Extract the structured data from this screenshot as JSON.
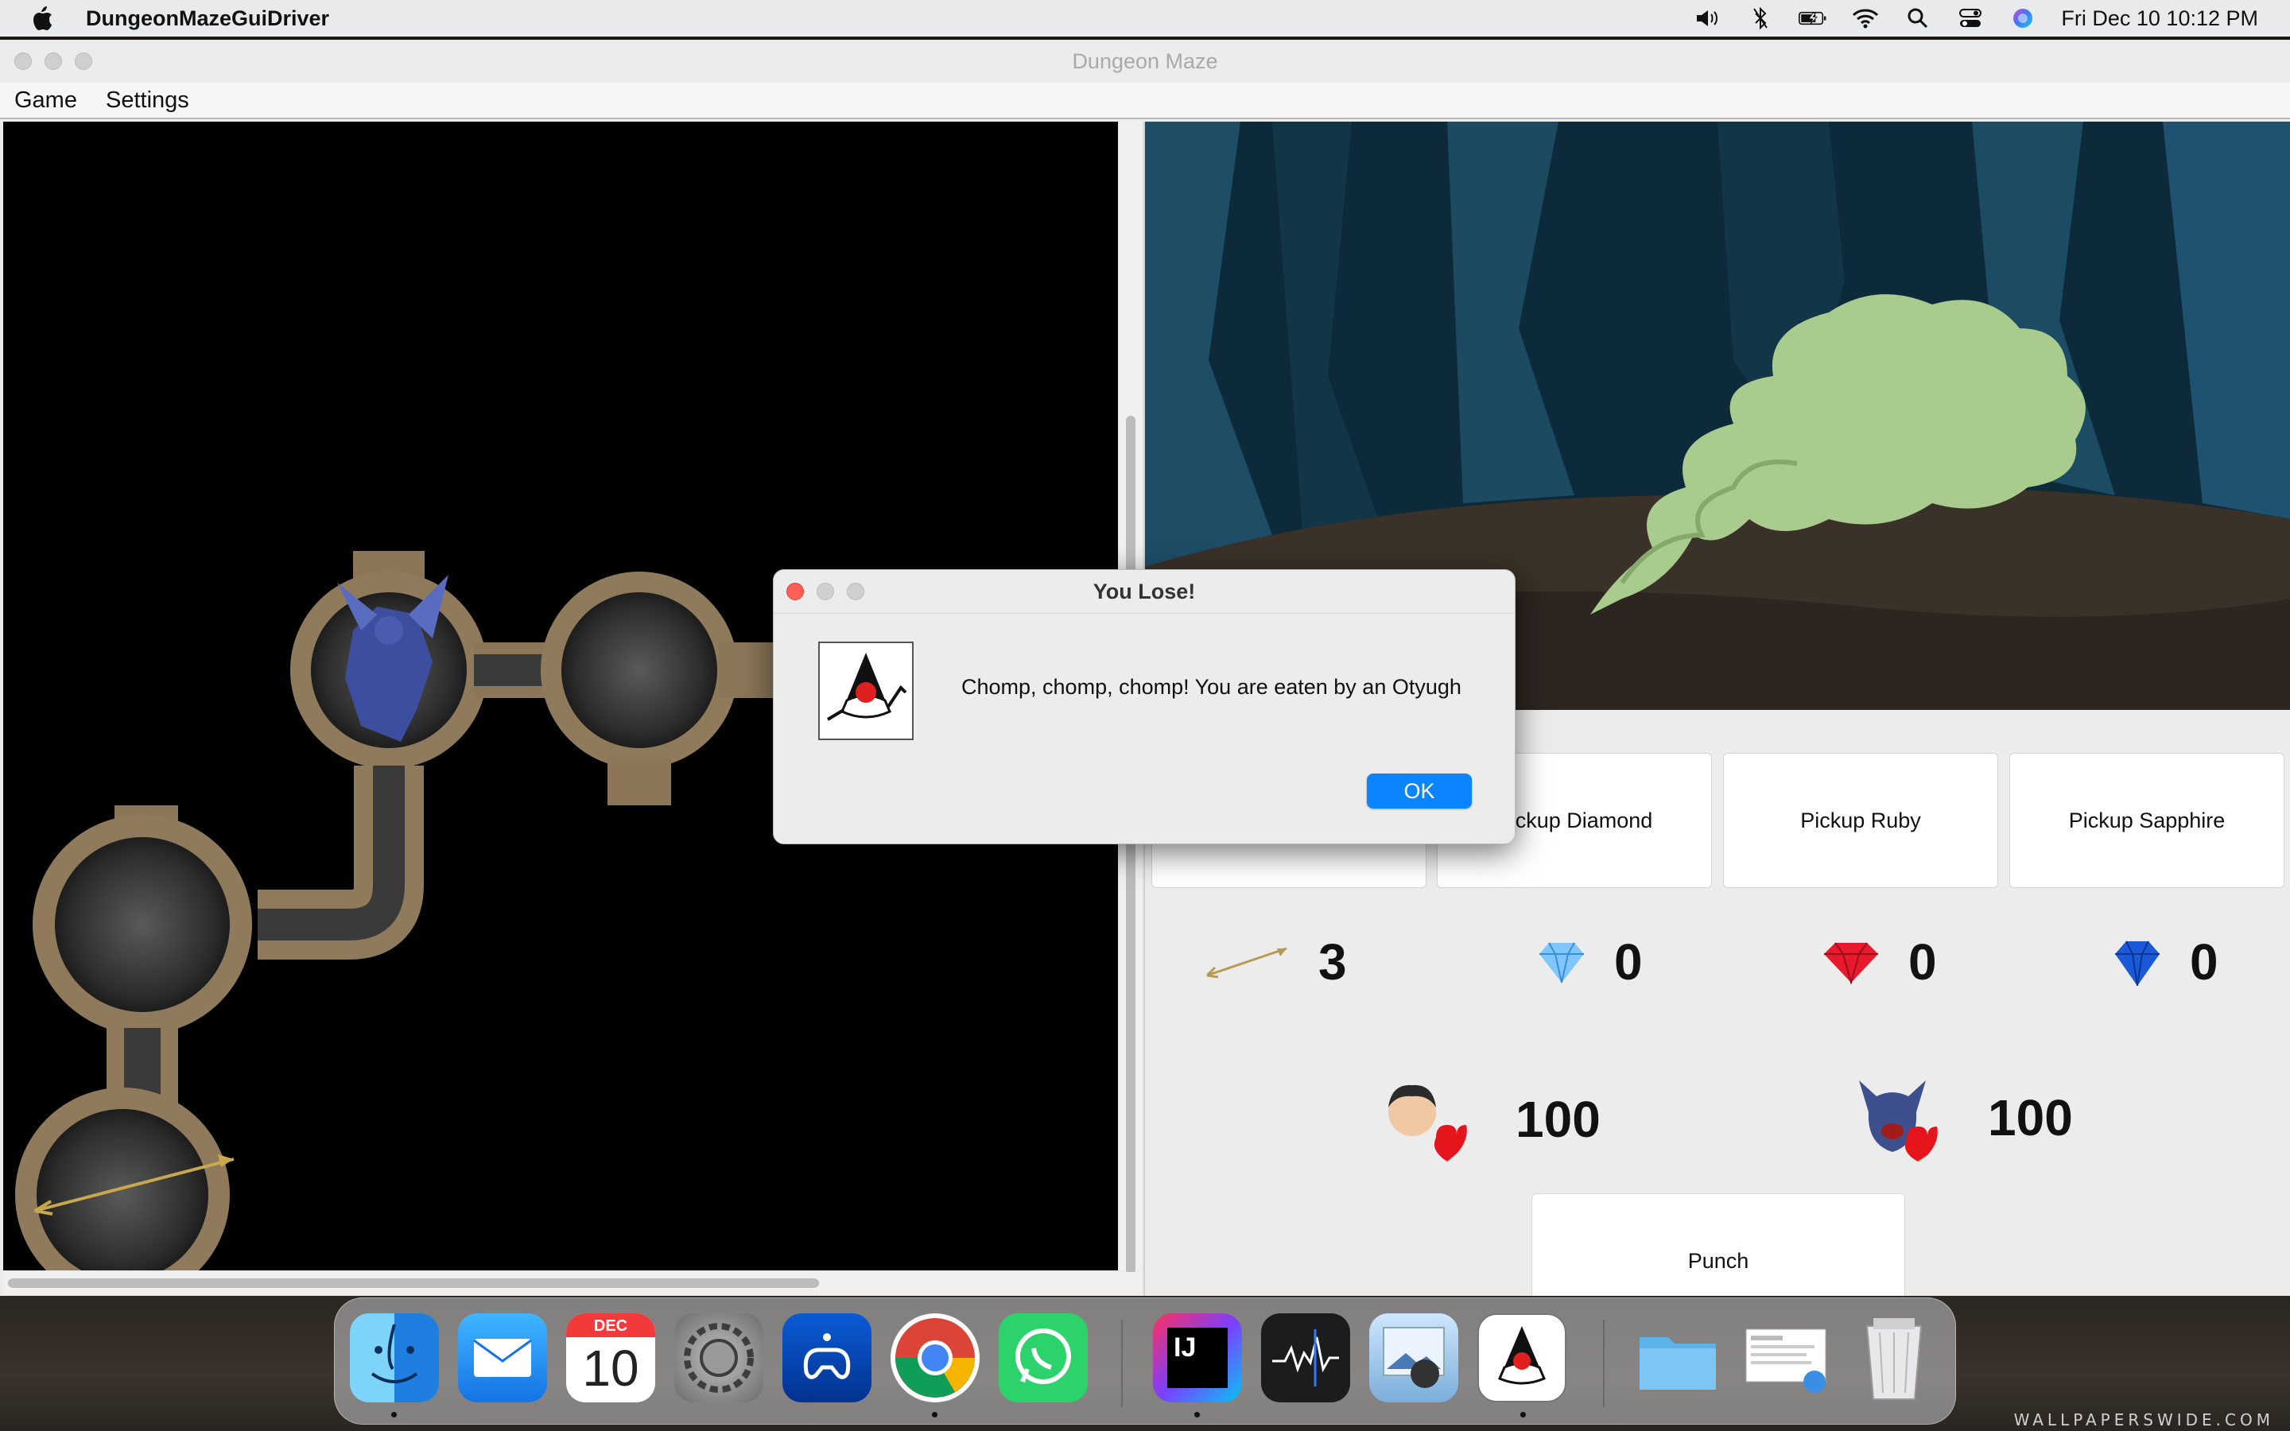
{
  "menubar": {
    "app_name": "DungeonMazeGuiDriver",
    "clock": "Fri Dec 10  10:12 PM"
  },
  "window": {
    "title": "Dungeon Maze",
    "menus": [
      "Game",
      "Settings"
    ]
  },
  "actions": {
    "pickup_diamond": "Pickup Diamond",
    "pickup_ruby": "Pickup Ruby",
    "pickup_sapphire": "Pickup Sapphire",
    "punch": "Punch"
  },
  "inventory": {
    "arrows": "3",
    "diamonds": "0",
    "rubies": "0",
    "sapphires": "0"
  },
  "health": {
    "player": "100",
    "monster": "100"
  },
  "dialog": {
    "title": "You Lose!",
    "message": "Chomp, chomp, chomp! You are eaten by an Otyugh",
    "ok_label": "OK"
  },
  "dock": {
    "apps": [
      "finder-icon",
      "mail-icon",
      "calendar-icon",
      "system-preferences-icon",
      "playstation-icon",
      "chrome-icon",
      "whatsapp-icon",
      "intellij-icon",
      "stocks-icon",
      "preview-icon",
      "java-icon",
      "folder-icon",
      "documents-stack-icon",
      "trash-icon"
    ],
    "calendar_month": "DEC",
    "calendar_day": "10"
  },
  "wallpaper_watermark": "WALLPAPERSWIDE.COM",
  "colors": {
    "ok_button": "#0a84ff",
    "close_red": "#ff5f57",
    "maze_bg": "#000000"
  }
}
